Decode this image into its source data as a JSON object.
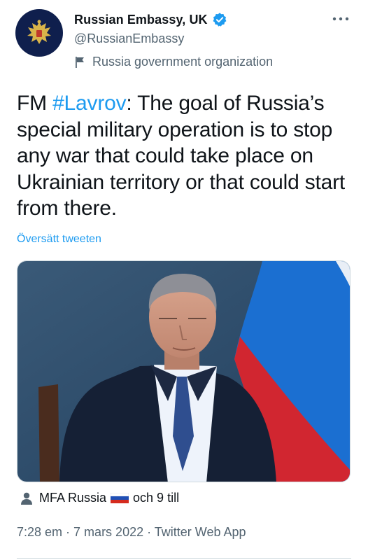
{
  "author": {
    "display_name": "Russian Embassy, UK",
    "handle": "@RussianEmbassy",
    "label": "Russia government organization",
    "verified": true
  },
  "tweet": {
    "prefix": "FM ",
    "hashtag": "#Lavrov",
    "body": ": The goal of Russia’s special military operation is to stop any war that could take place on Ukrainian territory or that could start from there.",
    "translate_link": "Översätt tweeten"
  },
  "media_tag": {
    "account": "MFA Russia",
    "suffix": "och 9 till"
  },
  "meta": {
    "time": "7:28 em",
    "separator": " · ",
    "date": "7 mars 2022",
    "source": "Twitter Web App"
  },
  "colors": {
    "accent": "#1d9bf0",
    "secondary_text": "#536471",
    "avatar_bg": "#0f1f4d"
  },
  "icons": [
    "eagle-emblem-icon",
    "verified-badge-icon",
    "more-dots-icon",
    "flag-label-icon",
    "person-icon",
    "russian-flag-icon"
  ]
}
